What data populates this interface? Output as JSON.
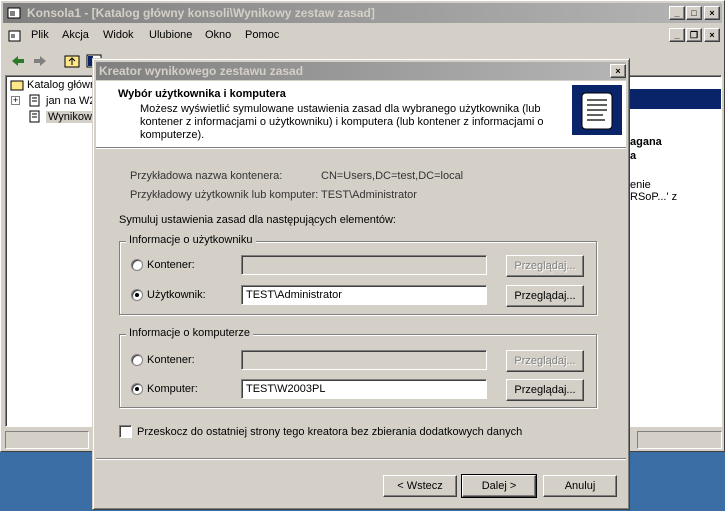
{
  "main_window": {
    "title": "Konsola1 - [Katalog główny konsoli\\Wynikowy zestaw zasad]",
    "menu": [
      "Plik",
      "Akcja",
      "Widok",
      "Ulubione",
      "Okno",
      "Pomoc"
    ],
    "tree": [
      "Katalog główn",
      "jan na W2",
      "Wynikowy"
    ],
    "right_pane_fragments": [
      "agana",
      "a",
      "enie",
      "RSoP...' z"
    ]
  },
  "dialog": {
    "title": "Kreator wynikowego zestawu zasad",
    "header_title": "Wybór użytkownika i komputera",
    "header_desc": "Możesz wyświetlić symulowane ustawienia zasad dla wybranego użytkownika (lub kontener z informacjami o użytkowniku) i komputera (lub kontener z informacjami o komputerze).",
    "sample_container_label": "Przykładowa nazwa kontenera:",
    "sample_container_value": "CN=Users,DC=test,DC=local",
    "sample_user_label": "Przykładowy użytkownik lub komputer:",
    "sample_user_value": "TEST\\Administrator",
    "simulate_label": "Symuluj ustawienia zasad dla następujących elementów:",
    "user_group": {
      "legend": "Informacje o użytkowniku",
      "container_label": "Kontener:",
      "container_value": "",
      "user_label": "Użytkownik:",
      "user_value": "TEST\\Administrator",
      "selected": "user"
    },
    "computer_group": {
      "legend": "Informacje o komputerze",
      "container_label": "Kontener:",
      "container_value": "",
      "computer_label": "Komputer:",
      "computer_value": "TEST\\W2003PL",
      "selected": "computer"
    },
    "browse_label": "Przeglądaj...",
    "skip_label": "Przeskocz do ostatniej strony tego kreatora bez zbierania dodatkowych danych",
    "skip_checked": false,
    "buttons": {
      "back": "< Wstecz",
      "next": "Dalej >",
      "cancel": "Anuluj"
    }
  },
  "colors": {
    "face": "#d4d0c8",
    "desktop": "#3a6ea5",
    "inactive_title": "#808080"
  }
}
